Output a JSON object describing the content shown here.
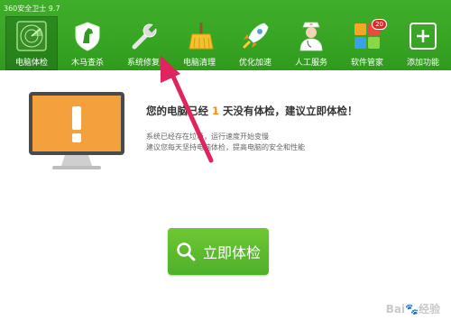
{
  "app": {
    "title": "360安全卫士 9.7"
  },
  "nav": [
    {
      "label": "电脑体检",
      "icon": "radar-icon",
      "active": true
    },
    {
      "label": "木马查杀",
      "icon": "horse-shield-icon"
    },
    {
      "label": "系统修复",
      "icon": "wrench-icon"
    },
    {
      "label": "电脑清理",
      "icon": "broom-icon"
    },
    {
      "label": "优化加速",
      "icon": "rocket-icon"
    },
    {
      "label": "人工服务",
      "icon": "doctor-icon"
    },
    {
      "label": "软件管家",
      "icon": "apps-icon",
      "badge": "20"
    },
    {
      "label": "添加功能",
      "icon": "plus-icon"
    }
  ],
  "main": {
    "headline_prefix": "您的电脑已经",
    "days": "1",
    "headline_suffix": "天没有体检，建议立即体检！",
    "line1": "系统已经存在垃圾，运行速度开始变慢",
    "line2": "建议您每天坚持电脑体检，提高电脑的安全和性能",
    "button_label": "立即体检"
  },
  "watermark": "Bai🐾经验",
  "colors": {
    "topbar": "#38a424",
    "accent": "#ff8a00",
    "button": "#5cba2e",
    "arrow": "#e0245e"
  }
}
